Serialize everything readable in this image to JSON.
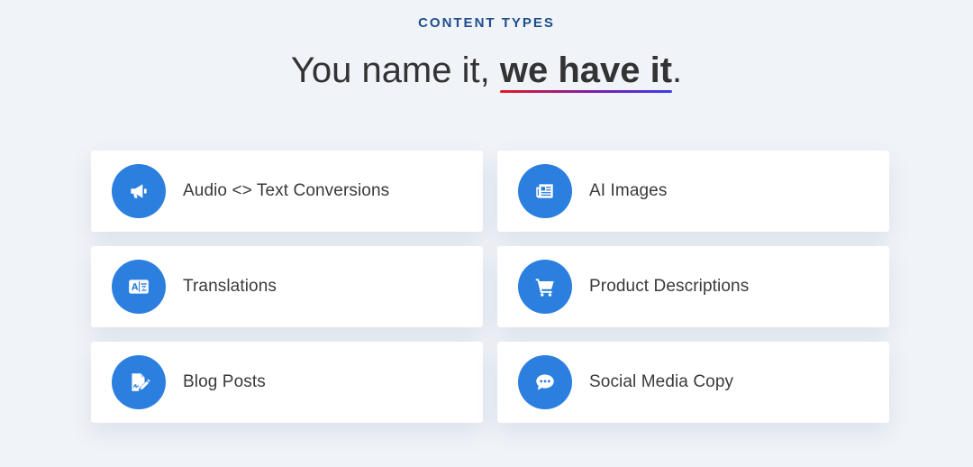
{
  "section": {
    "eyebrow": "CONTENT TYPES",
    "headline_plain": "You name it, ",
    "headline_highlight": "we have it",
    "headline_end": "."
  },
  "cards": [
    {
      "label": "Audio <> Text Conversions",
      "icon": "megaphone-icon"
    },
    {
      "label": "AI Images",
      "icon": "newspaper-icon"
    },
    {
      "label": "Translations",
      "icon": "language-icon"
    },
    {
      "label": "Product Descriptions",
      "icon": "shopping-cart-icon"
    },
    {
      "label": "Blog Posts",
      "icon": "file-signature-icon"
    },
    {
      "label": "Social Media Copy",
      "icon": "comment-dots-icon"
    }
  ],
  "colors": {
    "background": "#f0f4f9",
    "eyebrow": "#1f4e8c",
    "icon_circle": "#2b7fde",
    "underline_start": "#e31b23",
    "underline_end": "#3c3ee8"
  }
}
